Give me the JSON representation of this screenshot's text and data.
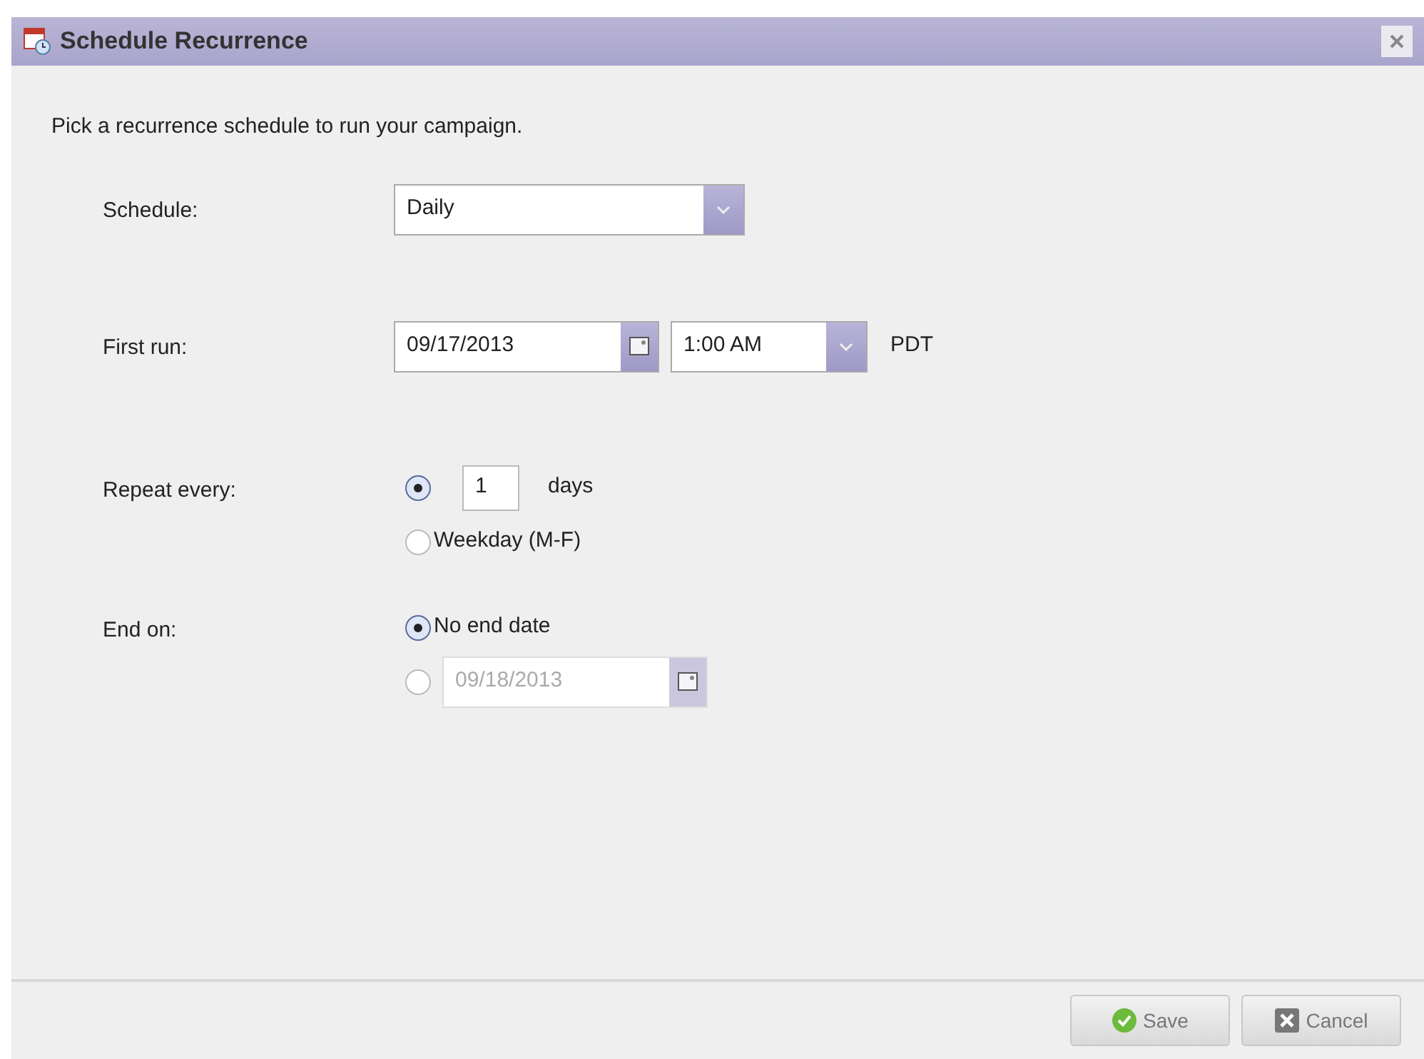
{
  "window": {
    "title": "Schedule Recurrence"
  },
  "intro": "Pick a recurrence schedule to run your campaign.",
  "schedule": {
    "label": "Schedule:",
    "value": "Daily"
  },
  "first_run": {
    "label": "First run:",
    "date": "09/17/2013",
    "time": "1:00 AM",
    "timezone": "PDT"
  },
  "repeat": {
    "label": "Repeat every:",
    "options": [
      {
        "kind": "count",
        "value": "1",
        "unit": "days",
        "selected": true
      },
      {
        "kind": "text",
        "text": "Weekday (M-F)",
        "selected": false
      }
    ]
  },
  "end": {
    "label": "End on:",
    "options": [
      {
        "kind": "text",
        "text": "No end date",
        "selected": true
      },
      {
        "kind": "date",
        "value": "09/18/2013",
        "disabled": true,
        "selected": false
      }
    ]
  },
  "buttons": [
    {
      "kind": "save",
      "label": "Save"
    },
    {
      "kind": "cancel",
      "label": "Cancel"
    }
  ]
}
